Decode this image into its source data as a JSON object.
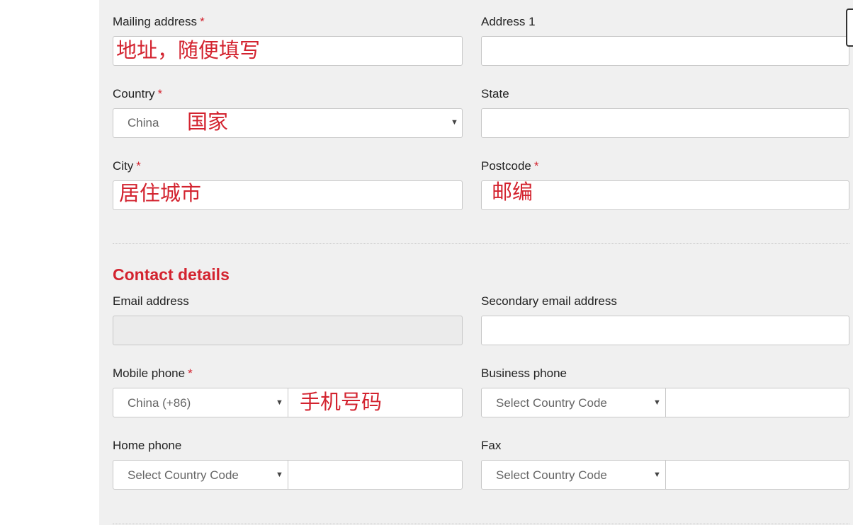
{
  "address": {
    "mailing_label": "Mailing address",
    "mailing_note": "地址，随便填写",
    "address1_label": "Address 1",
    "country_label": "Country",
    "country_value": "China",
    "country_note": "国家",
    "state_label": "State",
    "city_label": "City",
    "city_note": "居住城市",
    "postcode_label": "Postcode",
    "postcode_note": "邮编",
    "required_mark": "*"
  },
  "contact": {
    "section_title": "Contact details",
    "email_label": "Email address",
    "secondary_email_label": "Secondary email address",
    "mobile_label": "Mobile phone",
    "mobile_code": "China (+86)",
    "mobile_note": "手机号码",
    "business_label": "Business phone",
    "business_code": "Select Country Code",
    "home_label": "Home phone",
    "home_code": "Select Country Code",
    "fax_label": "Fax",
    "fax_code": "Select Country Code"
  },
  "icons": {
    "caret": "▼"
  },
  "colors": {
    "accent": "#d3232f",
    "panel_background": "#f0f0f0"
  }
}
